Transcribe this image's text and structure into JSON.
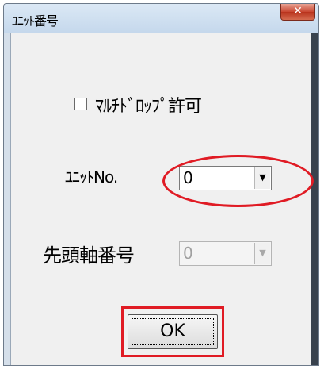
{
  "window": {
    "title": "ﾕﾆｯﾄ番号",
    "close_symbol": "✕"
  },
  "multidrop": {
    "label": "ﾏﾙﾁﾄﾞﾛｯﾌﾟ許可",
    "checked": false
  },
  "unit_no": {
    "label": "ﾕﾆｯﾄNo.",
    "value": "0",
    "arrow": "▼"
  },
  "head_axis": {
    "label": "先頭軸番号",
    "value": "0",
    "arrow": "▼",
    "enabled": false
  },
  "ok_button": {
    "label": "OK"
  },
  "annotations": {
    "highlight_color": "#e01b24"
  }
}
